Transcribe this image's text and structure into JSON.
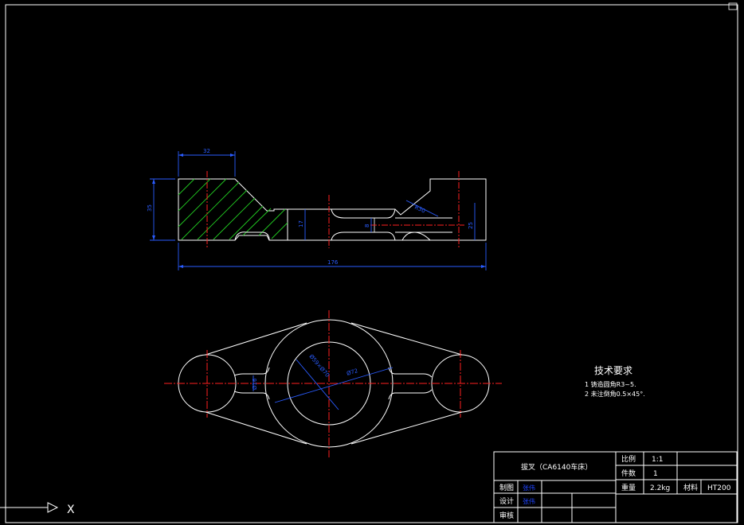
{
  "drawing": {
    "dimensions": {
      "top_width": "32",
      "left_height": "35",
      "total_length": "176",
      "neck_height": "17",
      "slot_height": "8",
      "right_height": "25",
      "chamfer": "R30",
      "bore_large": "Ø59×Ø70",
      "bore_small": "Ø72",
      "hub_small": "Ø16"
    },
    "notes": {
      "title": "技术要求",
      "line1": "1 铸造圆角R3~5.",
      "line2": "2 未注倒角0.5×45°."
    },
    "axis_label": "X"
  },
  "title_block": {
    "part_name": "拔叉（CA6140车床）",
    "scale_label": "比例",
    "scale_value": "1:1",
    "qty_label": "件数",
    "qty_value": "1",
    "weight_label": "重量",
    "weight_value": "2.2kg",
    "material_label": "材料",
    "material_value": "HT200",
    "drawn_label": "制图",
    "drawn_value": "张伟",
    "design_label": "设计",
    "design_value": "张伟",
    "check_label": "审核"
  },
  "colors": {
    "outline": "#ffffff",
    "center_line": "#ff2020",
    "dimension": "#2a5cff",
    "hatch": "#22cc22"
  }
}
